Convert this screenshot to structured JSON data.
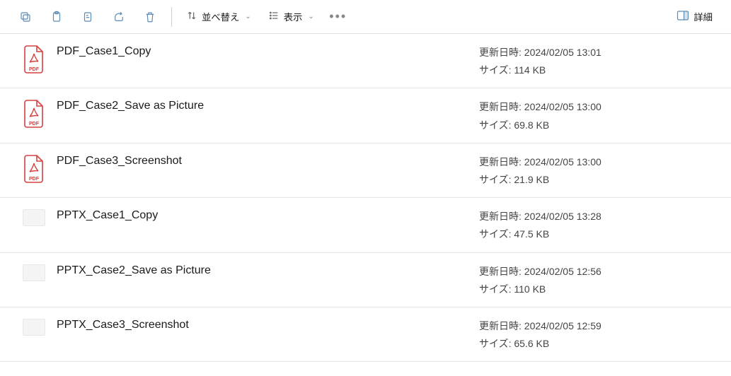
{
  "toolbar": {
    "sort_label": "並べ替え",
    "view_label": "表示",
    "details_label": "詳細"
  },
  "meta_labels": {
    "modified": "更新日時:",
    "size": "サイズ:"
  },
  "files": [
    {
      "name": "PDF_Case1_Copy",
      "type": "pdf",
      "modified": "2024/02/05 13:01",
      "size": "114 KB"
    },
    {
      "name": "PDF_Case2_Save as Picture",
      "type": "pdf",
      "modified": "2024/02/05 13:00",
      "size": "69.8 KB"
    },
    {
      "name": "PDF_Case3_Screenshot",
      "type": "pdf",
      "modified": "2024/02/05 13:00",
      "size": "21.9 KB"
    },
    {
      "name": "PPTX_Case1_Copy",
      "type": "pptx",
      "modified": "2024/02/05 13:28",
      "size": "47.5 KB"
    },
    {
      "name": "PPTX_Case2_Save as Picture",
      "type": "pptx",
      "modified": "2024/02/05 12:56",
      "size": "110 KB"
    },
    {
      "name": "PPTX_Case3_Screenshot",
      "type": "pptx",
      "modified": "2024/02/05 12:59",
      "size": "65.6 KB"
    }
  ]
}
